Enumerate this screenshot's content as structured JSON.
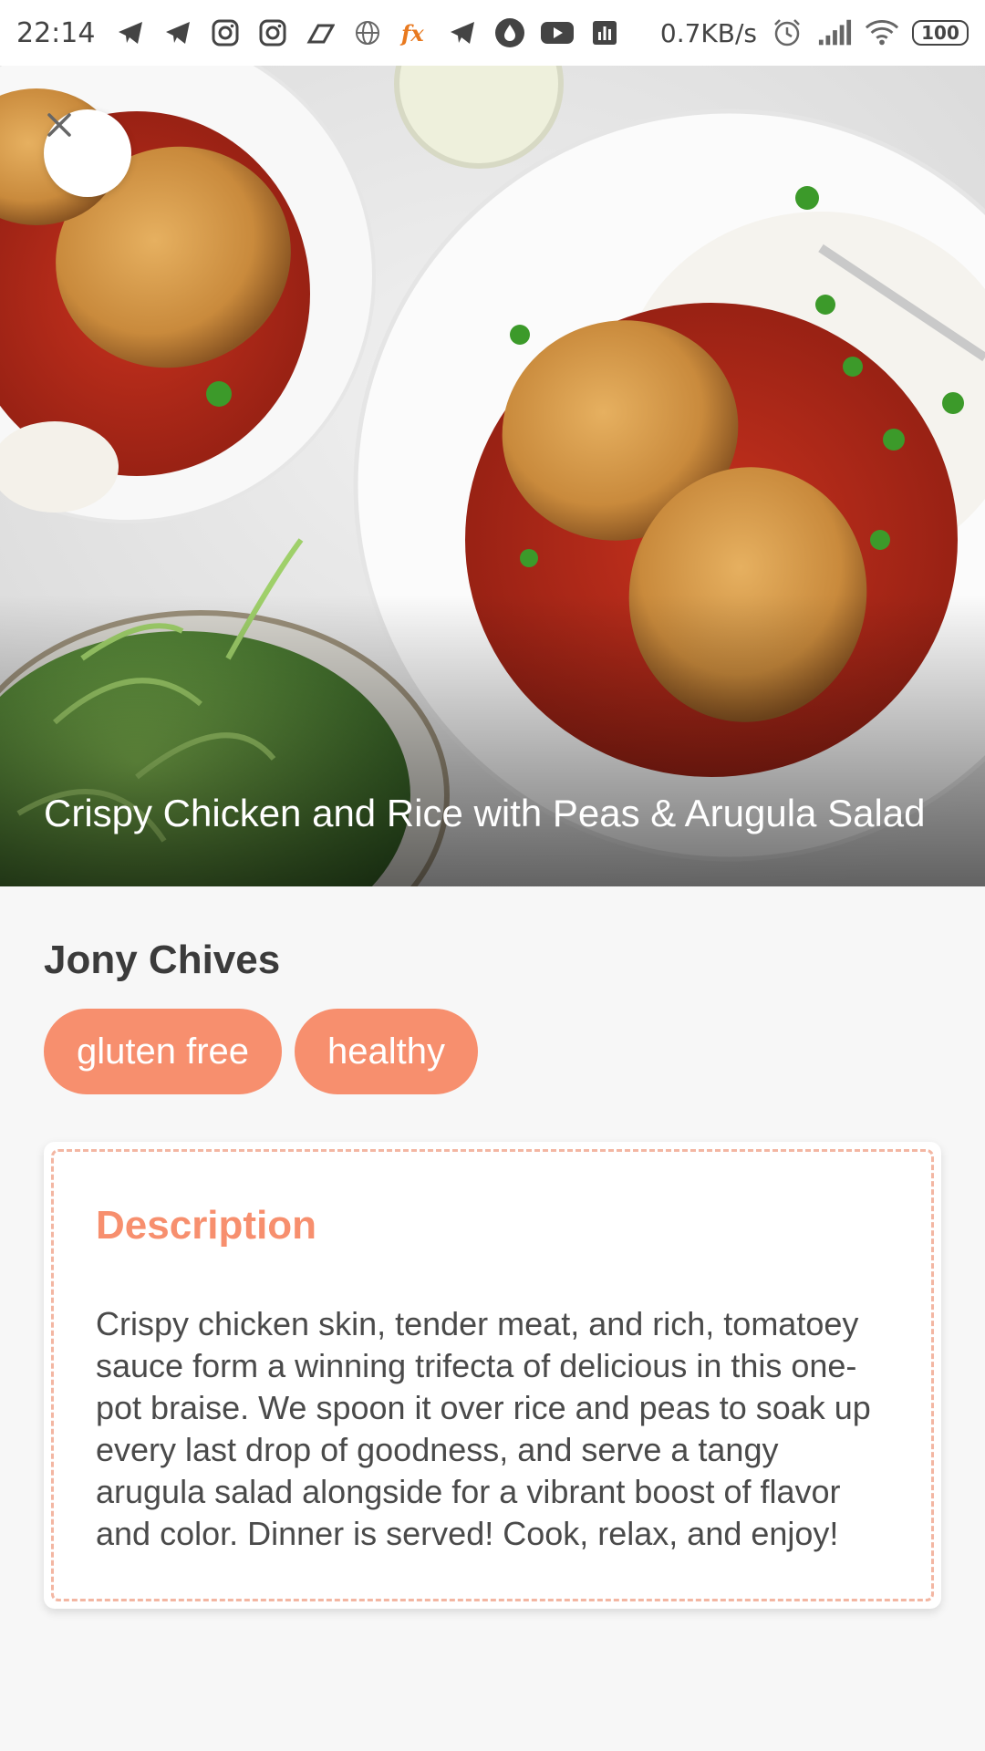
{
  "status_bar": {
    "time": "22:14",
    "net_speed": "0.7KB/s",
    "battery": "100",
    "icons": [
      "telegram-icon",
      "telegram-icon",
      "instagram-icon",
      "instagram-icon",
      "app-icon",
      "globe-icon",
      "fx-icon",
      "telegram-icon",
      "drop-icon",
      "youtube-icon",
      "chart-icon",
      "alarm-icon",
      "signal-icon",
      "wifi-icon",
      "battery-icon"
    ]
  },
  "hero": {
    "title": "Crispy Chicken and Rice with Peas & Arugula Salad",
    "close_icon": "close-icon"
  },
  "recipe": {
    "author": "Jony Chives",
    "tags": [
      "gluten free",
      "healthy"
    ],
    "description_heading": "Description",
    "description": "Crispy chicken skin, tender meat, and rich, tomatoey sauce form a winning trifecta of delicious in this one-pot braise. We spoon it over rice and peas to soak up every last drop of goodness, and serve a tangy arugula salad alongside for a vibrant boost of flavor and color. Dinner is served! Cook, relax, and enjoy!"
  },
  "colors": {
    "accent": "#f78f6e",
    "dashed_border": "#f3b6a2",
    "background": "#f7f7f7"
  }
}
